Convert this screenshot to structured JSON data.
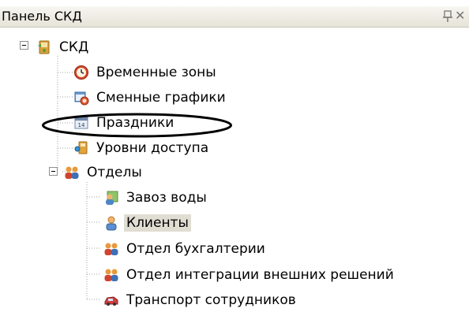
{
  "panel": {
    "title": "Панель СКД",
    "close_glyph": "✕"
  },
  "tree": {
    "root": {
      "label": "СКД",
      "icon": "skd-icon"
    },
    "items": [
      {
        "label": "Временные зоны",
        "icon": "clock-icon"
      },
      {
        "label": "Сменные графики",
        "icon": "calendar-clock-icon"
      },
      {
        "label": "Праздники",
        "icon": "calendar-icon",
        "highlighted": true
      },
      {
        "label": "Уровни доступа",
        "icon": "key-card-icon"
      },
      {
        "label": "Отделы",
        "icon": "users-group-icon"
      }
    ],
    "departments": [
      {
        "label": "Завоз воды",
        "icon": "user-green-icon"
      },
      {
        "label": "Клиенты",
        "icon": "user-icon",
        "selected": true
      },
      {
        "label": "Отдел бухгалтерии",
        "icon": "users-group-icon"
      },
      {
        "label": "Отдел интеграции внешних решений",
        "icon": "users-group-icon"
      },
      {
        "label": "Транспорт сотрудников",
        "icon": "car-icon"
      }
    ]
  },
  "colors": {
    "selection": "#e0ddd3",
    "tree_lines": "#a0a0a0",
    "highlight_ellipse": "#000000"
  }
}
